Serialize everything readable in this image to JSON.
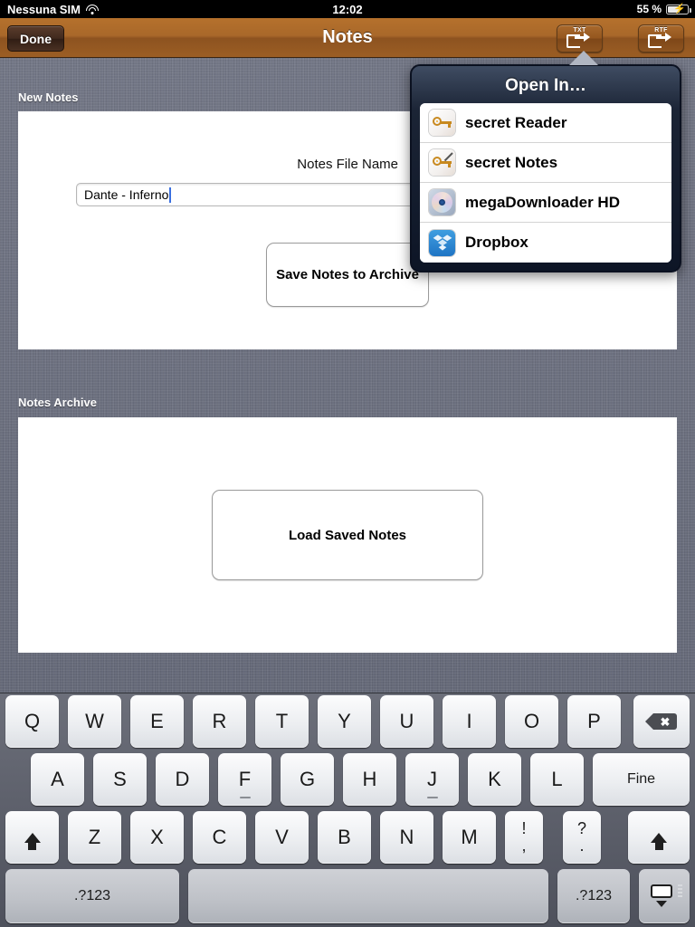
{
  "status_bar": {
    "carrier": "Nessuna SIM",
    "wifi_icon": "wifi-icon",
    "time": "12:02",
    "battery_percent": "55 %",
    "battery_icon": "battery-charging-icon"
  },
  "nav_bar": {
    "title": "Notes",
    "done_label": "Done",
    "export_txt_label": "TXT",
    "export_rtf_label": "RTF",
    "export_icon": "share-export-icon"
  },
  "sections": {
    "new_notes_label": "New Notes",
    "notes_archive_label": "Notes Archive"
  },
  "new_notes": {
    "file_name_label": "Notes File Name",
    "file_name_value": "Dante - Inferno",
    "file_name_placeholder": "Notes File Name",
    "save_button_label": "Save Notes to Archive"
  },
  "notes_archive": {
    "load_button_label": "Load Saved Notes"
  },
  "popover": {
    "title": "Open In…",
    "items": [
      {
        "label": "secret Reader",
        "icon": "key-app-icon"
      },
      {
        "label": "secret Notes",
        "icon": "key-pen-app-icon"
      },
      {
        "label": "megaDownloader HD",
        "icon": "disc-app-icon"
      },
      {
        "label": "Dropbox",
        "icon": "dropbox-app-icon"
      }
    ]
  },
  "keyboard": {
    "row1": [
      "Q",
      "W",
      "E",
      "R",
      "T",
      "Y",
      "U",
      "I",
      "O",
      "P"
    ],
    "row1_delete_icon": "backspace-icon",
    "row2": [
      "A",
      "S",
      "D",
      "F",
      "G",
      "H",
      "J",
      "K",
      "L"
    ],
    "row2_return_label": "Fine",
    "row3": [
      "Z",
      "X",
      "C",
      "V",
      "B",
      "N",
      "M"
    ],
    "row3_shift_icon": "shift-icon",
    "row3_punct_1_top": "!",
    "row3_punct_1_bottom": ",",
    "row3_punct_2_top": "?",
    "row3_punct_2_bottom": ".",
    "row4_numbers_left": ".?123",
    "row4_numbers_right": ".?123",
    "row4_space_label": "",
    "row4_dismiss_icon": "hide-keyboard-icon"
  },
  "colors": {
    "nav_bar_brown": "#a9682a",
    "backdrop_gray": "#6a6e7d",
    "popover_navy": "#0d1526",
    "caret_blue": "#3a6fe0",
    "dropbox_blue": "#1f74c4"
  }
}
